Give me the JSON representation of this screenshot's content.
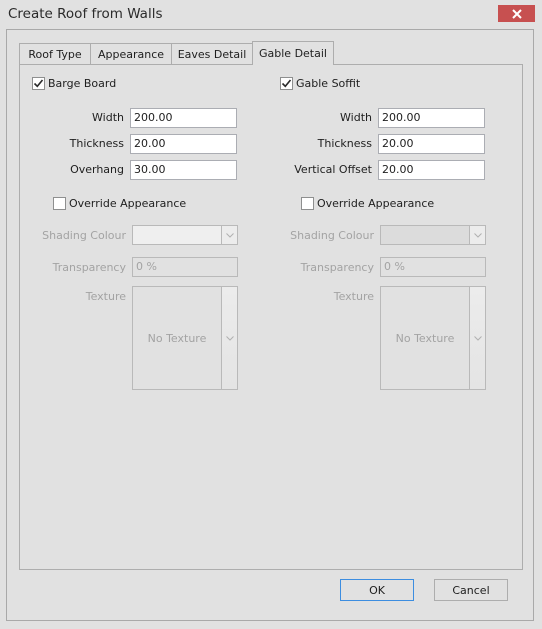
{
  "window": {
    "title": "Create Roof from Walls",
    "close_icon": "close-x-icon"
  },
  "tabs": [
    {
      "label": "Roof Type",
      "active": false
    },
    {
      "label": "Appearance",
      "active": false
    },
    {
      "label": "Eaves Detail",
      "active": false
    },
    {
      "label": "Gable Detail",
      "active": true
    }
  ],
  "barge_board": {
    "label": "Barge Board",
    "checked": true,
    "fields": [
      {
        "label": "Width",
        "value": "200.00"
      },
      {
        "label": "Thickness",
        "value": "20.00"
      },
      {
        "label": "Overhang",
        "value": "30.00"
      }
    ],
    "override_appearance": {
      "label": "Override Appearance",
      "checked": false
    },
    "shading_colour": {
      "label": "Shading Colour",
      "value": ""
    },
    "transparency": {
      "label": "Transparency",
      "value": "0 %"
    },
    "texture": {
      "label": "Texture",
      "value": "No Texture"
    }
  },
  "gable_soffit": {
    "label": "Gable Soffit",
    "checked": true,
    "fields": [
      {
        "label": "Width",
        "value": "200.00"
      },
      {
        "label": "Thickness",
        "value": "20.00"
      },
      {
        "label": "Vertical Offset",
        "value": "20.00"
      }
    ],
    "override_appearance": {
      "label": "Override Appearance",
      "checked": false
    },
    "shading_colour": {
      "label": "Shading Colour",
      "value": ""
    },
    "transparency": {
      "label": "Transparency",
      "value": "0 %"
    },
    "texture": {
      "label": "Texture",
      "value": "No Texture"
    }
  },
  "buttons": {
    "ok": "OK",
    "cancel": "Cancel"
  },
  "colors": {
    "close_button": "#c75050",
    "default_button_border": "#3c8de0",
    "background": "#e1e1e1"
  }
}
